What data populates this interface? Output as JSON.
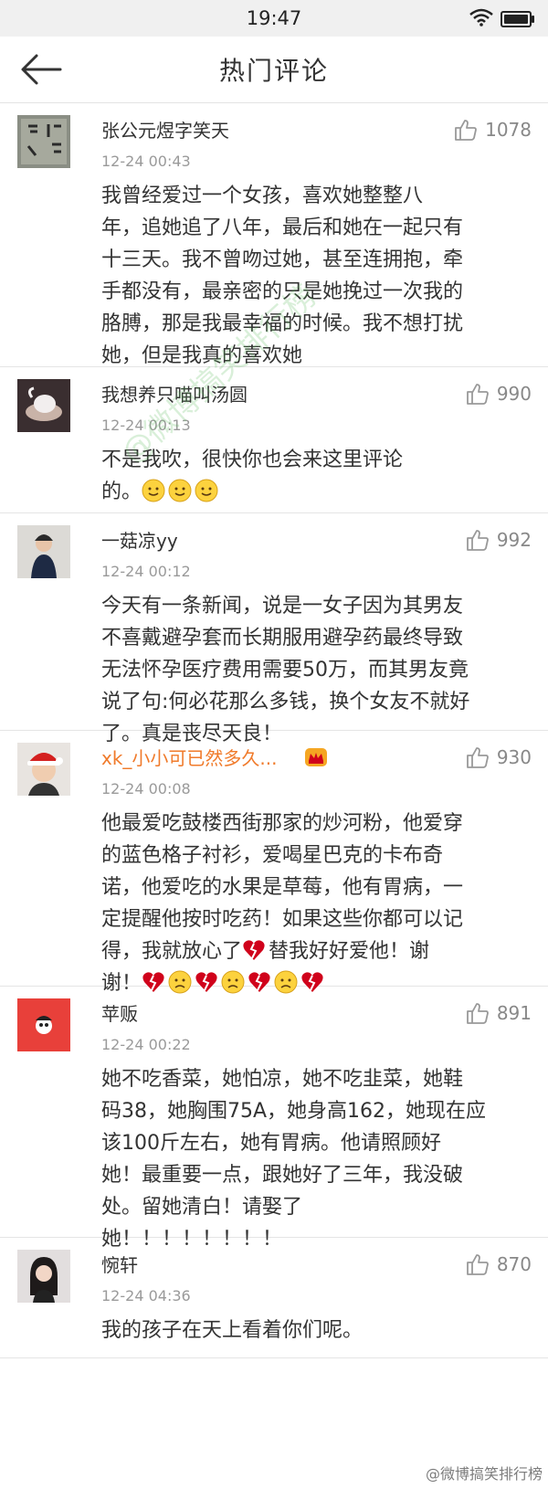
{
  "status_bar": {
    "time": "19:47"
  },
  "nav": {
    "title": "热门评论"
  },
  "comments": [
    {
      "user": "张公元煜字笑天",
      "likes": "1078",
      "time": "12-24 00:43",
      "text": "我曾经爱过一个女孩，喜欢她整整八\n年，追她追了八年，最后和她在一起只有\n十三天。我不曾吻过她，甚至连拥抱，牵\n手都没有，最亲密的只是她挽过一次我的\n胳膊，那是我最幸福的时候。我不想打扰\n她，但是我真的喜欢她"
    },
    {
      "user": "我想养只喵叫汤圆",
      "likes": "990",
      "time": "12-24 00:13",
      "text": "不是我吹，很快你也会来这里评论\n的。"
    },
    {
      "user": "一菇凉yy",
      "likes": "992",
      "time": "12-24 00:12",
      "text": "今天有一条新闻，说是一女子因为其男友\n不喜戴避孕套而长期服用避孕药最终导致\n无法怀孕医疗费用需要50万，而其男友竟\n说了句:何必花那么多钱，换个女友不就好\n了。真是丧尽天良！"
    },
    {
      "user": "xk_小小可已然多久...",
      "likes": "930",
      "time": "12-24 00:08",
      "text_a": "他最爱吃鼓楼西街那家的炒河粉，他爱穿\n的蓝色格子衬衫，爱喝星巴克的卡布奇\n诺，他爱吃的水果是草莓，他有胃病，一\n定提醒他按时吃药！如果这些你都可以记\n得，我就放心了",
      "text_b": "替我好好爱他！谢\n谢！"
    },
    {
      "user": "苹贩",
      "likes": "891",
      "time": "12-24 00:22",
      "text": "她不吃香菜，她怕凉，她不吃韭菜，她鞋\n码38，她胸围75A，她身高162，她现在应\n该100斤左右，她有胃病。他请照顾好\n她！最重要一点，跟她好了三年，我没破\n处。留她清白！请娶了\n她！！！！！！！！"
    },
    {
      "user": "惋轩",
      "likes": "870",
      "time": "12-24 04:36",
      "text": "我的孩子在天上看着你们呢。"
    }
  ],
  "watermark": {
    "corner": "@微博搞笑排行榜",
    "middle": "@微博搞笑排行榜"
  }
}
